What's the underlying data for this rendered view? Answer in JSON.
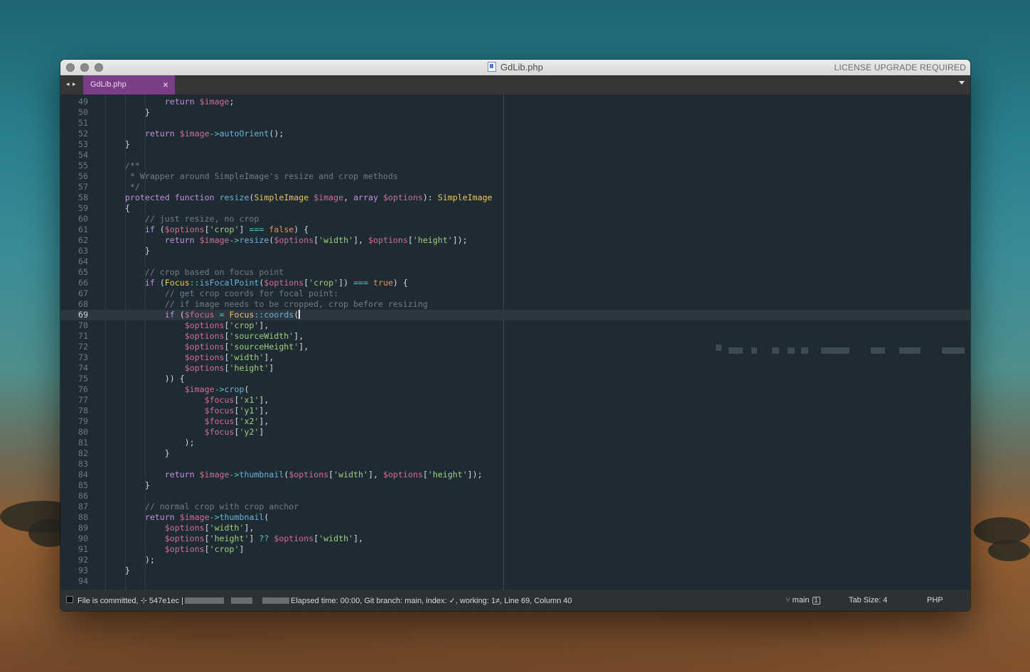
{
  "window": {
    "title": "GdLib.php",
    "license_notice": "LICENSE UPGRADE REQUIRED",
    "nav_arrows": "◂ ▸",
    "active_tab": "GdLib.php",
    "tab_close": "×"
  },
  "editor": {
    "active_line": "69",
    "lines": [
      {
        "n": "49",
        "code": [
          [
            "            ",
            "p"
          ],
          [
            "return ",
            "k"
          ],
          [
            "$image",
            "v"
          ],
          [
            ";",
            "p"
          ]
        ]
      },
      {
        "n": "50",
        "code": [
          [
            "        }",
            "p"
          ]
        ]
      },
      {
        "n": "51",
        "code": []
      },
      {
        "n": "52",
        "code": [
          [
            "        ",
            "p"
          ],
          [
            "return ",
            "k"
          ],
          [
            "$image",
            "v"
          ],
          [
            "->",
            "o"
          ],
          [
            "autoOrient",
            "f"
          ],
          [
            "();",
            "p"
          ]
        ]
      },
      {
        "n": "53",
        "code": [
          [
            "    }",
            "p"
          ]
        ]
      },
      {
        "n": "54",
        "code": []
      },
      {
        "n": "55",
        "code": [
          [
            "    /**",
            "c"
          ]
        ]
      },
      {
        "n": "56",
        "code": [
          [
            "     * Wrapper around SimpleImage's resize and crop methods",
            "c"
          ]
        ]
      },
      {
        "n": "57",
        "code": [
          [
            "     */",
            "c"
          ]
        ]
      },
      {
        "n": "58",
        "code": [
          [
            "    ",
            "p"
          ],
          [
            "protected ",
            "k"
          ],
          [
            "function ",
            "k"
          ],
          [
            "resize",
            "f"
          ],
          [
            "(",
            "p"
          ],
          [
            "SimpleImage ",
            "t"
          ],
          [
            "$image",
            "v"
          ],
          [
            ", ",
            "p"
          ],
          [
            "array ",
            "k"
          ],
          [
            "$options",
            "v"
          ],
          [
            "): ",
            "p"
          ],
          [
            "SimpleImage",
            "t"
          ]
        ]
      },
      {
        "n": "59",
        "code": [
          [
            "    {",
            "p"
          ]
        ]
      },
      {
        "n": "60",
        "code": [
          [
            "        // just resize, no crop",
            "c"
          ]
        ]
      },
      {
        "n": "61",
        "code": [
          [
            "        ",
            "p"
          ],
          [
            "if ",
            "k"
          ],
          [
            "(",
            "p"
          ],
          [
            "$options",
            "v"
          ],
          [
            "[",
            "p"
          ],
          [
            "'crop'",
            "s"
          ],
          [
            "] ",
            "p"
          ],
          [
            "=== ",
            "o"
          ],
          [
            "false",
            "bool"
          ],
          [
            ") {",
            "p"
          ]
        ]
      },
      {
        "n": "62",
        "code": [
          [
            "            ",
            "p"
          ],
          [
            "return ",
            "k"
          ],
          [
            "$image",
            "v"
          ],
          [
            "->",
            "o"
          ],
          [
            "resize",
            "f"
          ],
          [
            "(",
            "p"
          ],
          [
            "$options",
            "v"
          ],
          [
            "[",
            "p"
          ],
          [
            "'width'",
            "s"
          ],
          [
            "], ",
            "p"
          ],
          [
            "$options",
            "v"
          ],
          [
            "[",
            "p"
          ],
          [
            "'height'",
            "s"
          ],
          [
            "]);",
            "p"
          ]
        ]
      },
      {
        "n": "63",
        "code": [
          [
            "        }",
            "p"
          ]
        ]
      },
      {
        "n": "64",
        "code": []
      },
      {
        "n": "65",
        "code": [
          [
            "        // crop based on focus point",
            "c"
          ]
        ]
      },
      {
        "n": "66",
        "code": [
          [
            "        ",
            "p"
          ],
          [
            "if ",
            "k"
          ],
          [
            "(",
            "p"
          ],
          [
            "Focus",
            "t"
          ],
          [
            "::",
            "o"
          ],
          [
            "isFocalPoint",
            "f"
          ],
          [
            "(",
            "p"
          ],
          [
            "$options",
            "v"
          ],
          [
            "[",
            "p"
          ],
          [
            "'crop'",
            "s"
          ],
          [
            "]) ",
            "p"
          ],
          [
            "=== ",
            "o"
          ],
          [
            "true",
            "bool"
          ],
          [
            ") {",
            "p"
          ]
        ]
      },
      {
        "n": "67",
        "code": [
          [
            "            // get crop coords for focal point:",
            "c"
          ]
        ]
      },
      {
        "n": "68",
        "code": [
          [
            "            // if image needs to be cropped, crop before resizing",
            "c"
          ]
        ]
      },
      {
        "n": "69",
        "code": [
          [
            "            ",
            "p"
          ],
          [
            "if ",
            "k"
          ],
          [
            "(",
            "p"
          ],
          [
            "$focus ",
            "v"
          ],
          [
            "= ",
            "o"
          ],
          [
            "Focus",
            "t"
          ],
          [
            "::",
            "o"
          ],
          [
            "coords",
            "f"
          ],
          [
            "(",
            "p"
          ]
        ]
      },
      {
        "n": "70",
        "code": [
          [
            "                ",
            "p"
          ],
          [
            "$options",
            "v"
          ],
          [
            "[",
            "p"
          ],
          [
            "'crop'",
            "s"
          ],
          [
            "],",
            "p"
          ]
        ]
      },
      {
        "n": "71",
        "code": [
          [
            "                ",
            "p"
          ],
          [
            "$options",
            "v"
          ],
          [
            "[",
            "p"
          ],
          [
            "'sourceWidth'",
            "s"
          ],
          [
            "],",
            "p"
          ]
        ]
      },
      {
        "n": "72",
        "code": [
          [
            "                ",
            "p"
          ],
          [
            "$options",
            "v"
          ],
          [
            "[",
            "p"
          ],
          [
            "'sourceHeight'",
            "s"
          ],
          [
            "],",
            "p"
          ]
        ]
      },
      {
        "n": "73",
        "code": [
          [
            "                ",
            "p"
          ],
          [
            "$options",
            "v"
          ],
          [
            "[",
            "p"
          ],
          [
            "'width'",
            "s"
          ],
          [
            "],",
            "p"
          ]
        ]
      },
      {
        "n": "74",
        "code": [
          [
            "                ",
            "p"
          ],
          [
            "$options",
            "v"
          ],
          [
            "[",
            "p"
          ],
          [
            "'height'",
            "s"
          ],
          [
            "]",
            "p"
          ]
        ]
      },
      {
        "n": "75",
        "code": [
          [
            "            )) {",
            "p"
          ]
        ]
      },
      {
        "n": "76",
        "code": [
          [
            "                ",
            "p"
          ],
          [
            "$image",
            "v"
          ],
          [
            "->",
            "o"
          ],
          [
            "crop",
            "f"
          ],
          [
            "(",
            "p"
          ]
        ]
      },
      {
        "n": "77",
        "code": [
          [
            "                    ",
            "p"
          ],
          [
            "$focus",
            "v"
          ],
          [
            "[",
            "p"
          ],
          [
            "'x1'",
            "s"
          ],
          [
            "],",
            "p"
          ]
        ]
      },
      {
        "n": "78",
        "code": [
          [
            "                    ",
            "p"
          ],
          [
            "$focus",
            "v"
          ],
          [
            "[",
            "p"
          ],
          [
            "'y1'",
            "s"
          ],
          [
            "],",
            "p"
          ]
        ]
      },
      {
        "n": "79",
        "code": [
          [
            "                    ",
            "p"
          ],
          [
            "$focus",
            "v"
          ],
          [
            "[",
            "p"
          ],
          [
            "'x2'",
            "s"
          ],
          [
            "],",
            "p"
          ]
        ]
      },
      {
        "n": "80",
        "code": [
          [
            "                    ",
            "p"
          ],
          [
            "$focus",
            "v"
          ],
          [
            "[",
            "p"
          ],
          [
            "'y2'",
            "s"
          ],
          [
            "]",
            "p"
          ]
        ]
      },
      {
        "n": "81",
        "code": [
          [
            "                );",
            "p"
          ]
        ]
      },
      {
        "n": "82",
        "code": [
          [
            "            }",
            "p"
          ]
        ]
      },
      {
        "n": "83",
        "code": []
      },
      {
        "n": "84",
        "code": [
          [
            "            ",
            "p"
          ],
          [
            "return ",
            "k"
          ],
          [
            "$image",
            "v"
          ],
          [
            "->",
            "o"
          ],
          [
            "thumbnail",
            "f"
          ],
          [
            "(",
            "p"
          ],
          [
            "$options",
            "v"
          ],
          [
            "[",
            "p"
          ],
          [
            "'width'",
            "s"
          ],
          [
            "], ",
            "p"
          ],
          [
            "$options",
            "v"
          ],
          [
            "[",
            "p"
          ],
          [
            "'height'",
            "s"
          ],
          [
            "]);",
            "p"
          ]
        ]
      },
      {
        "n": "85",
        "code": [
          [
            "        }",
            "p"
          ]
        ]
      },
      {
        "n": "86",
        "code": []
      },
      {
        "n": "87",
        "code": [
          [
            "        // normal crop with crop anchor",
            "c"
          ]
        ]
      },
      {
        "n": "88",
        "code": [
          [
            "        ",
            "p"
          ],
          [
            "return ",
            "k"
          ],
          [
            "$image",
            "v"
          ],
          [
            "->",
            "o"
          ],
          [
            "thumbnail",
            "f"
          ],
          [
            "(",
            "p"
          ]
        ]
      },
      {
        "n": "89",
        "code": [
          [
            "            ",
            "p"
          ],
          [
            "$options",
            "v"
          ],
          [
            "[",
            "p"
          ],
          [
            "'width'",
            "s"
          ],
          [
            "],",
            "p"
          ]
        ]
      },
      {
        "n": "90",
        "code": [
          [
            "            ",
            "p"
          ],
          [
            "$options",
            "v"
          ],
          [
            "[",
            "p"
          ],
          [
            "'height'",
            "s"
          ],
          [
            "] ",
            "p"
          ],
          [
            "?? ",
            "o"
          ],
          [
            "$options",
            "v"
          ],
          [
            "[",
            "p"
          ],
          [
            "'width'",
            "s"
          ],
          [
            "],",
            "p"
          ]
        ]
      },
      {
        "n": "91",
        "code": [
          [
            "            ",
            "p"
          ],
          [
            "$options",
            "v"
          ],
          [
            "[",
            "p"
          ],
          [
            "'crop'",
            "s"
          ],
          [
            "]",
            "p"
          ]
        ]
      },
      {
        "n": "92",
        "code": [
          [
            "        );",
            "p"
          ]
        ]
      },
      {
        "n": "93",
        "code": [
          [
            "    }",
            "p"
          ]
        ]
      },
      {
        "n": "94",
        "code": []
      }
    ]
  },
  "statusbar": {
    "commit_text": "File is committed, ⊹ 547e1ec |",
    "info_text": "Elapsed time: 00:00, Git branch: main, index: ✓, working: 1≠, Line 69, Column 40",
    "branch_icon": "branch-icon",
    "branch": "main",
    "branch_badge": "1",
    "tab_size": "Tab Size: 4",
    "syntax": "PHP"
  },
  "colors": {
    "editor_bg": "#1f2b33",
    "tab_accent": "#7a3e86",
    "keyword": "#c78ce0",
    "function": "#6cb0d8",
    "type": "#f0c35a",
    "variable": "#d46c94",
    "string": "#9fcf7f",
    "comment": "#6e7d86"
  }
}
